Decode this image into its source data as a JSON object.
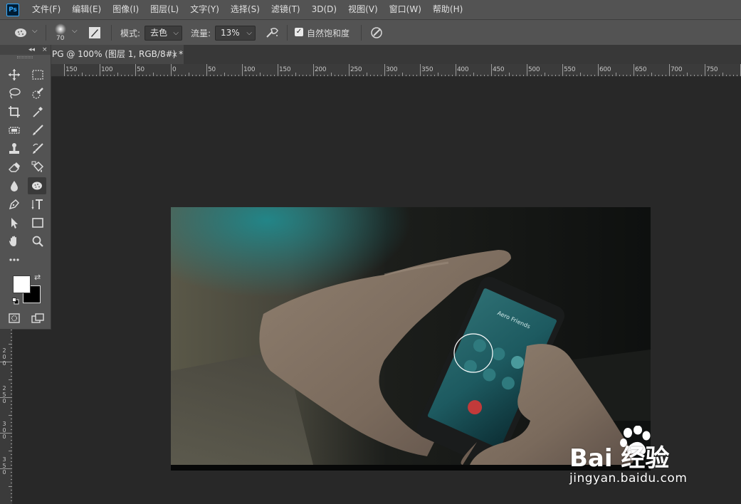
{
  "app": {
    "logo_text": "Ps"
  },
  "menu": [
    "文件(F)",
    "编辑(E)",
    "图像(I)",
    "图层(L)",
    "文字(Y)",
    "选择(S)",
    "滤镜(T)",
    "3D(D)",
    "视图(V)",
    "窗口(W)",
    "帮助(H)"
  ],
  "options": {
    "brush_size": "70",
    "mode_label": "模式:",
    "mode_value": "去色",
    "flow_label": "流量:",
    "flow_value": "13%",
    "vibrance_checked": true,
    "vibrance_label": "自然饱和度"
  },
  "document_tab": {
    "title": "PG @ 100% (图层 1, RGB/8#) *",
    "close": "×"
  },
  "toolbox_head": {
    "collapse": "◂◂",
    "close": "×"
  },
  "ruler_h_labels": [
    "150",
    "100",
    "50",
    "0",
    "50",
    "100",
    "150",
    "200",
    "250",
    "300",
    "350",
    "400",
    "450",
    "500",
    "550",
    "600",
    "650",
    "700",
    "750"
  ],
  "ruler_v_labels": [
    "2 0 0",
    "2 5 0",
    "3 0 0",
    "3 5 0"
  ],
  "phone_screen": {
    "caller_name": "Aero Friends"
  },
  "watermark": {
    "brand": "Bai 经验",
    "url": "jingyan.baidu.com"
  },
  "colors": {
    "foreground": "#ffffff",
    "background": "#000000",
    "accent": "#31a8ff"
  }
}
